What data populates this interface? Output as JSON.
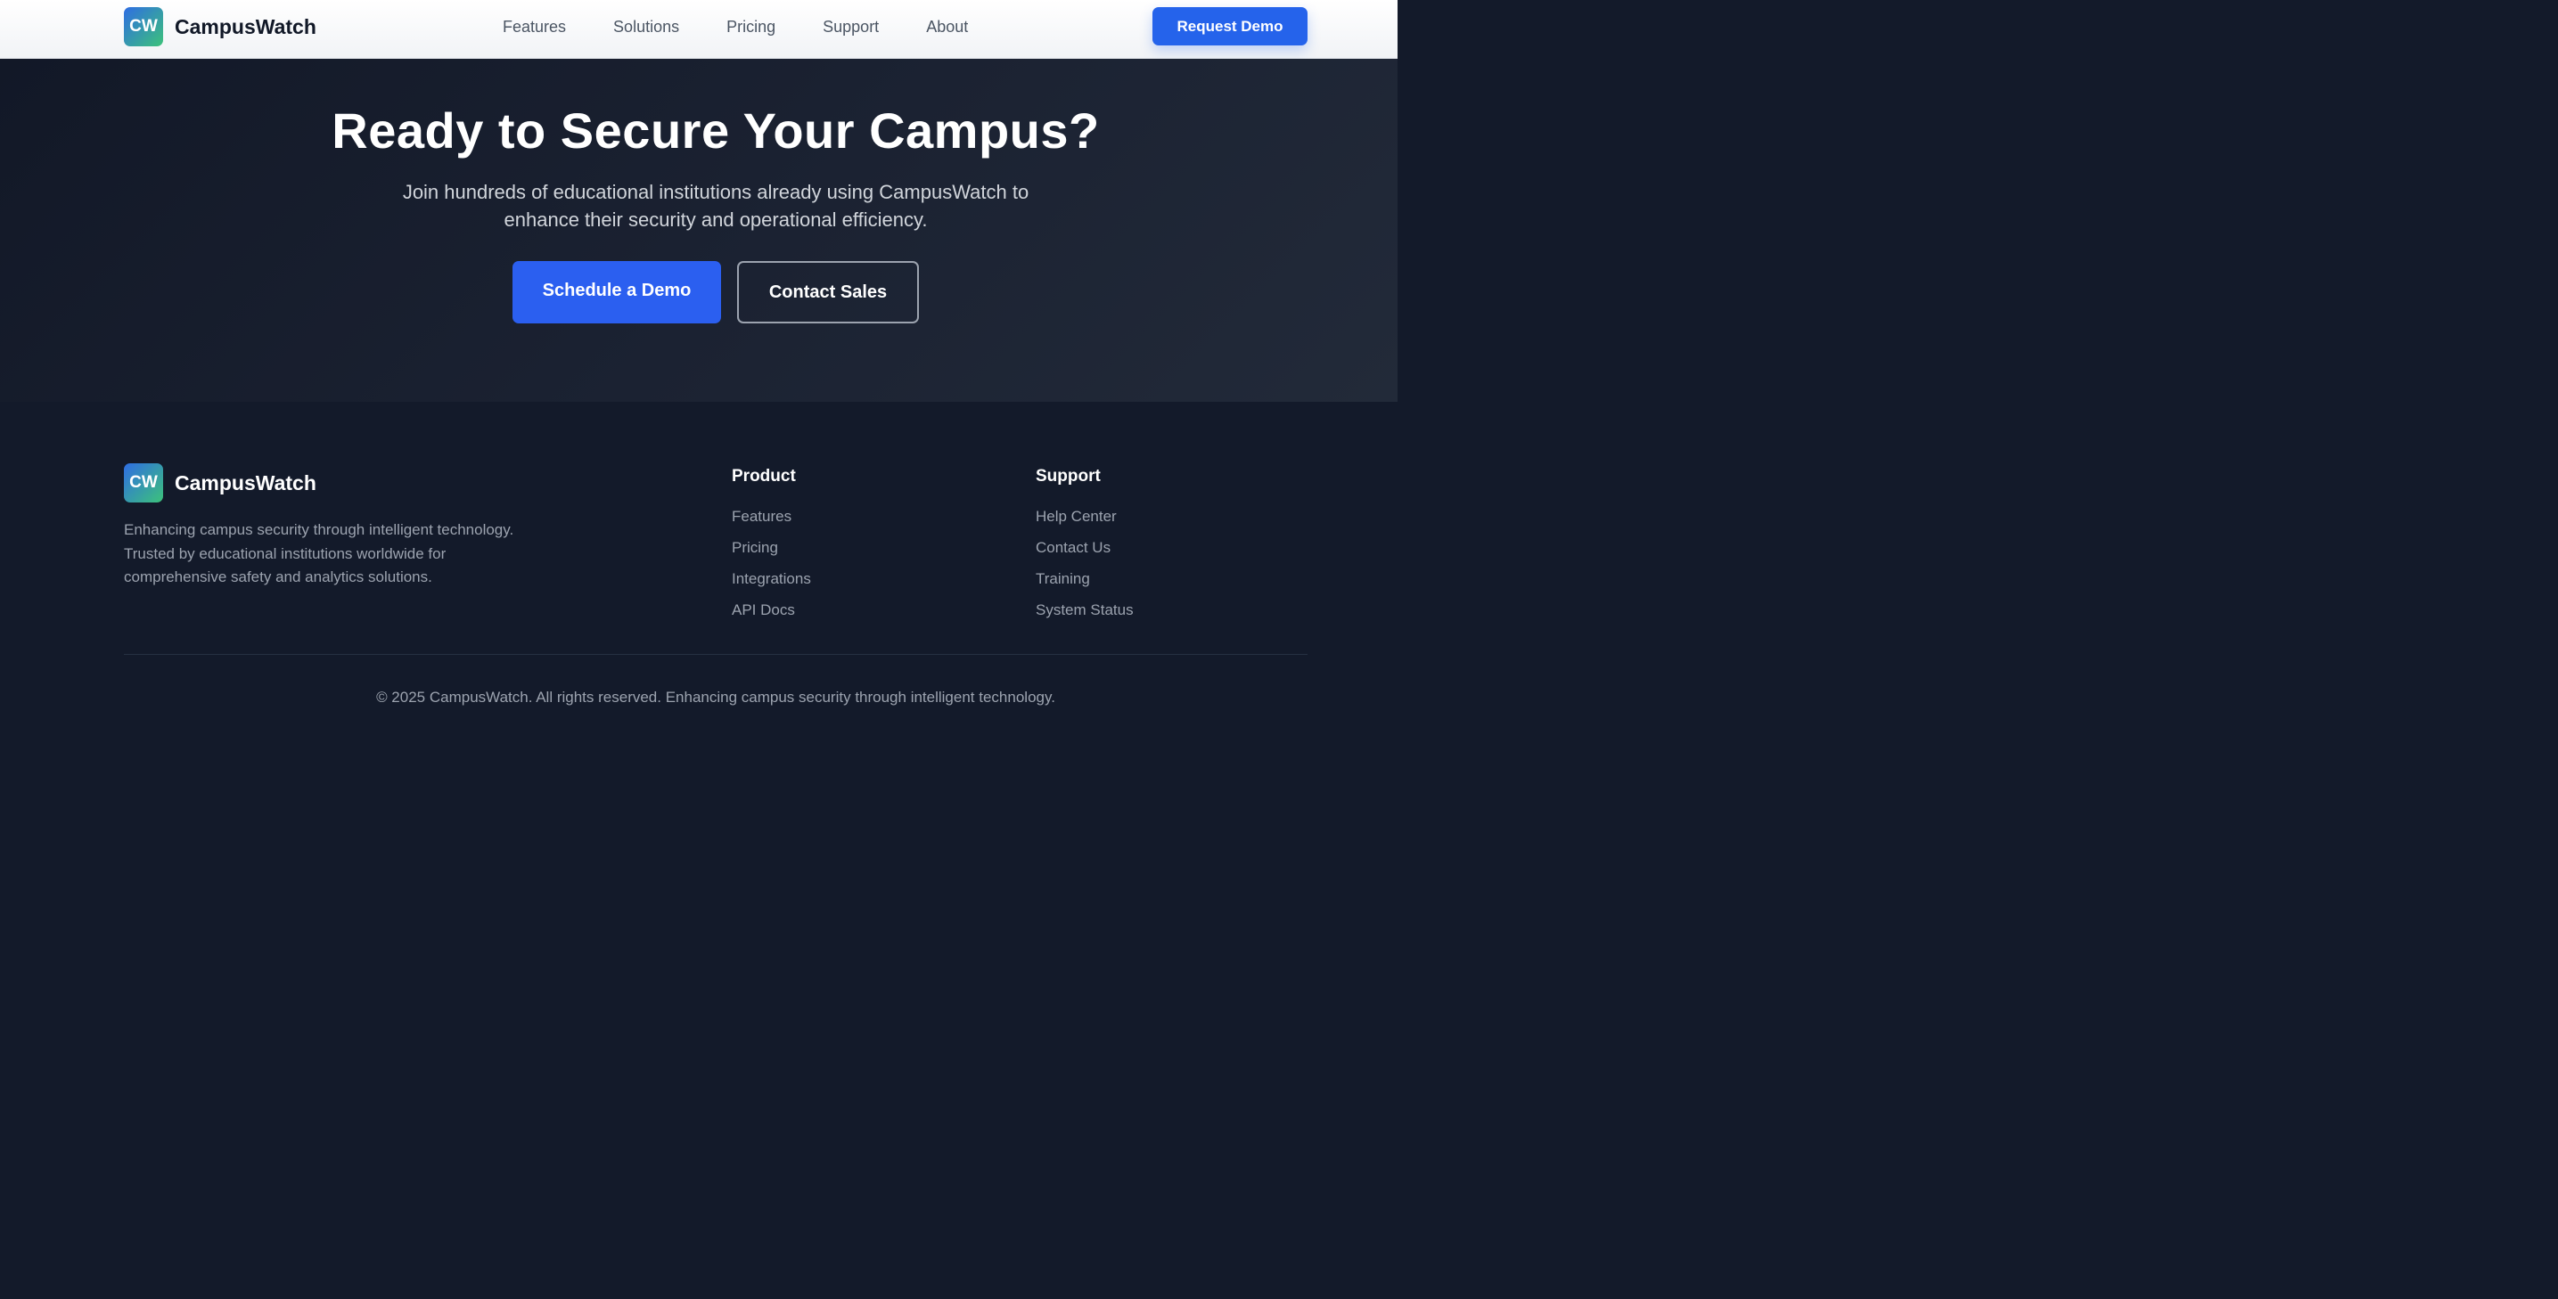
{
  "brand": {
    "mark": "CW",
    "name": "CampusWatch"
  },
  "nav": {
    "links": [
      "Features",
      "Solutions",
      "Pricing",
      "Support",
      "About"
    ],
    "cta": "Request Demo"
  },
  "hero": {
    "title": "Ready to Secure Your Campus?",
    "subtitle": "Join hundreds of educational institutions already using CampusWatch to enhance their security and operational efficiency.",
    "primary_button": "Schedule a Demo",
    "secondary_button": "Contact Sales"
  },
  "footer": {
    "description": "Enhancing campus security through intelligent technology. Trusted by educational institutions worldwide for comprehensive safety and analytics solutions.",
    "columns": [
      {
        "title": "Product",
        "links": [
          "Features",
          "Pricing",
          "Integrations",
          "API Docs"
        ]
      },
      {
        "title": "Support",
        "links": [
          "Help Center",
          "Contact Us",
          "Training",
          "System Status"
        ]
      }
    ],
    "copyright": "© 2025 CampusWatch. All rights reserved. Enhancing campus security through intelligent technology."
  },
  "colors": {
    "accent": "#2563eb",
    "dark_bg": "#131a2a",
    "logo_gradient_start": "#2f6de3",
    "logo_gradient_end": "#3cc27a"
  }
}
